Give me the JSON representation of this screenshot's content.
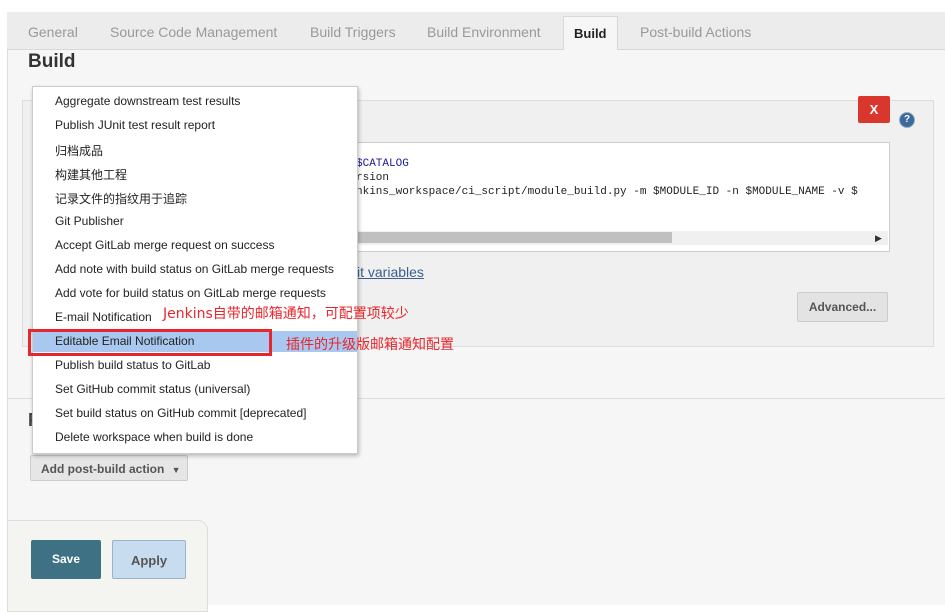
{
  "tabs": [
    "General",
    "Source Code Management",
    "Build Triggers",
    "Build Environment",
    "Build",
    "Post-build Actions"
  ],
  "active_tab": "Build",
  "section_title": "Build",
  "build_step": {
    "close_label": "X",
    "help_label": "?",
    "code_lines": [
      "$CATALOG",
      "rsion",
      "nkins_workspace/ci_script/module_build.py -m $MODULE_ID -n $MODULE_NAME -v $"
    ],
    "env_link": "it variables",
    "advanced_label": "Advanced..."
  },
  "post_build": {
    "heading": "P",
    "add_label": "Add post-build action"
  },
  "menu_items": [
    "Aggregate downstream test results",
    "Publish JUnit test result report",
    "归档成品",
    "构建其他工程",
    "记录文件的指纹用于追踪",
    "Git Publisher",
    "Accept GitLab merge request on success",
    "Add note with build status on GitLab merge requests",
    "Add vote for build status on GitLab merge requests",
    "E-mail Notification",
    "Editable Email Notification",
    "Publish build status to GitLab",
    "Set GitHub commit status (universal)",
    "Set build status on GitHub commit [deprecated]",
    "Delete workspace when build is done"
  ],
  "highlighted_item": "Editable Email Notification",
  "annotations": {
    "email_note": "Jenkins自带的邮箱通知，可配置项较少",
    "editable_note": "插件的升级版邮箱通知配置"
  },
  "buttons": {
    "save": "Save",
    "apply": "Apply"
  },
  "colors": {
    "accent_red": "#e8262d",
    "save_button": "#3e7183",
    "highlight": "#a9c8f0"
  }
}
